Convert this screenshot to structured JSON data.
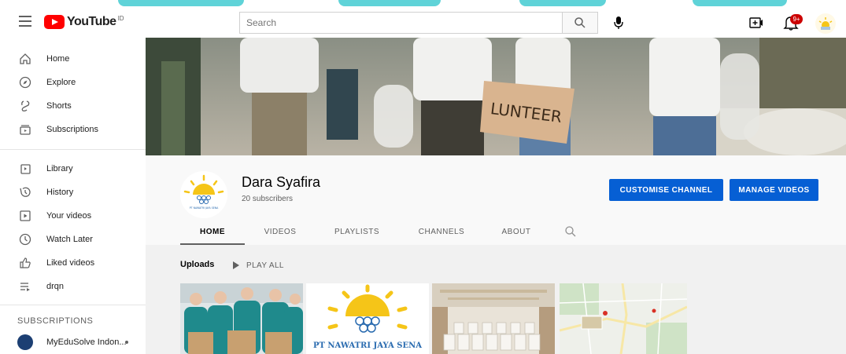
{
  "masthead": {
    "logo_text": "YouTube",
    "logo_sup": "ID",
    "search_placeholder": "Search",
    "notification_count": "9+"
  },
  "sidebar": {
    "primary": [
      {
        "label": "Home",
        "icon": "home-icon"
      },
      {
        "label": "Explore",
        "icon": "compass-icon"
      },
      {
        "label": "Shorts",
        "icon": "shorts-icon"
      },
      {
        "label": "Subscriptions",
        "icon": "subscriptions-icon"
      }
    ],
    "secondary": [
      {
        "label": "Library",
        "icon": "library-icon"
      },
      {
        "label": "History",
        "icon": "history-icon"
      },
      {
        "label": "Your videos",
        "icon": "your-videos-icon"
      },
      {
        "label": "Watch Later",
        "icon": "clock-icon"
      },
      {
        "label": "Liked videos",
        "icon": "thumbs-up-icon"
      },
      {
        "label": "drqn",
        "icon": "playlist-icon"
      }
    ],
    "subscriptions_heading": "SUBSCRIPTIONS",
    "subscriptions": [
      {
        "label": "MyEduSolve Indon..."
      }
    ]
  },
  "banner": {
    "sign_text": "LUNTEER"
  },
  "channel": {
    "name": "Dara Syafira",
    "subscribers": "20 subscribers",
    "customise_label": "CUSTOMISE CHANNEL",
    "manage_label": "MANAGE VIDEOS",
    "logo_caption": "PT NAWATRI JAYA SENA",
    "tabs": [
      {
        "label": "HOME",
        "active": true
      },
      {
        "label": "VIDEOS",
        "active": false
      },
      {
        "label": "PLAYLISTS",
        "active": false
      },
      {
        "label": "CHANNELS",
        "active": false
      },
      {
        "label": "ABOUT",
        "active": false
      }
    ]
  },
  "uploads": {
    "heading": "Uploads",
    "play_all_label": "PLAY ALL",
    "thumbnails": [
      {
        "kind": "volunteers-photo"
      },
      {
        "kind": "company-logo",
        "caption": "PT NAWATRI JAYA SENA"
      },
      {
        "kind": "meeting-room-photo"
      },
      {
        "kind": "map-image"
      }
    ]
  },
  "colors": {
    "accent_blue": "#065fd4",
    "youtube_red": "#ff0000",
    "logo_yellow": "#f5c518",
    "logo_blue": "#2b6cb0"
  }
}
